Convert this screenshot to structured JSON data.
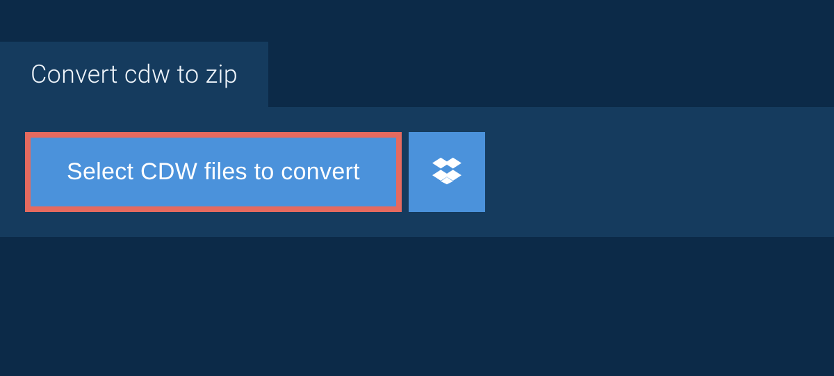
{
  "tab": {
    "label": "Convert cdw to zip"
  },
  "actions": {
    "select_label": "Select CDW files to convert"
  },
  "colors": {
    "page_bg": "#0c2a48",
    "panel_bg": "#153b5e",
    "button_bg": "#4b92db",
    "highlight_border": "#e56a5f",
    "text_light": "#ffffff"
  }
}
